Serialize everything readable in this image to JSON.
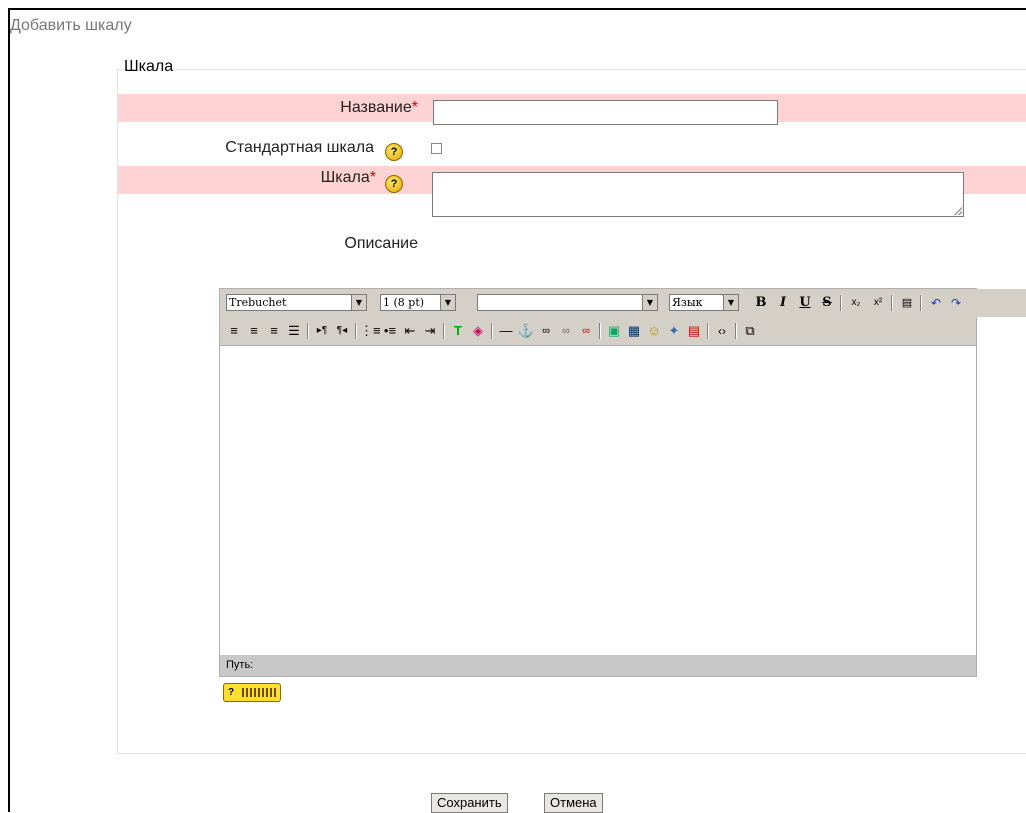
{
  "page": {
    "title": "Добавить шкалу"
  },
  "form": {
    "legend": "Шкала",
    "name_label": "Название",
    "required_mark": "*",
    "name_value": "",
    "standard_label": "Стандартная шкала",
    "standard_checked": false,
    "scale_label": "Шкала",
    "scale_value": "",
    "description_label": "Описание"
  },
  "editor": {
    "font_select": "Trebuchet",
    "size_select": "1 (8 pt)",
    "format_select": "",
    "lang_select": "Язык",
    "path_label": "Путь:",
    "toolbar1_icons": [
      "bold-icon",
      "italic-icon",
      "underline-icon",
      "strikethrough-icon",
      "subscript-icon",
      "superscript-icon",
      "paste-word-icon",
      "undo-icon",
      "redo-icon"
    ],
    "toolbar2_icons": [
      "align-left-icon",
      "align-center-icon",
      "align-right-icon",
      "align-justify-icon",
      "ltr-icon",
      "rtl-icon",
      "ordered-list-icon",
      "unordered-list-icon",
      "outdent-icon",
      "indent-icon",
      "text-color-icon",
      "highlight-color-icon",
      "horizontal-rule-icon",
      "anchor-icon",
      "link-icon",
      "unlink-icon",
      "nolink-icon",
      "insert-image-icon",
      "insert-table-icon",
      "smiley-icon",
      "special-chars-icon",
      "search-replace-icon",
      "html-source-icon",
      "fullscreen-icon"
    ]
  },
  "buttons": {
    "save": "Сохранить",
    "cancel": "Отмена"
  },
  "help_glyph": "?"
}
